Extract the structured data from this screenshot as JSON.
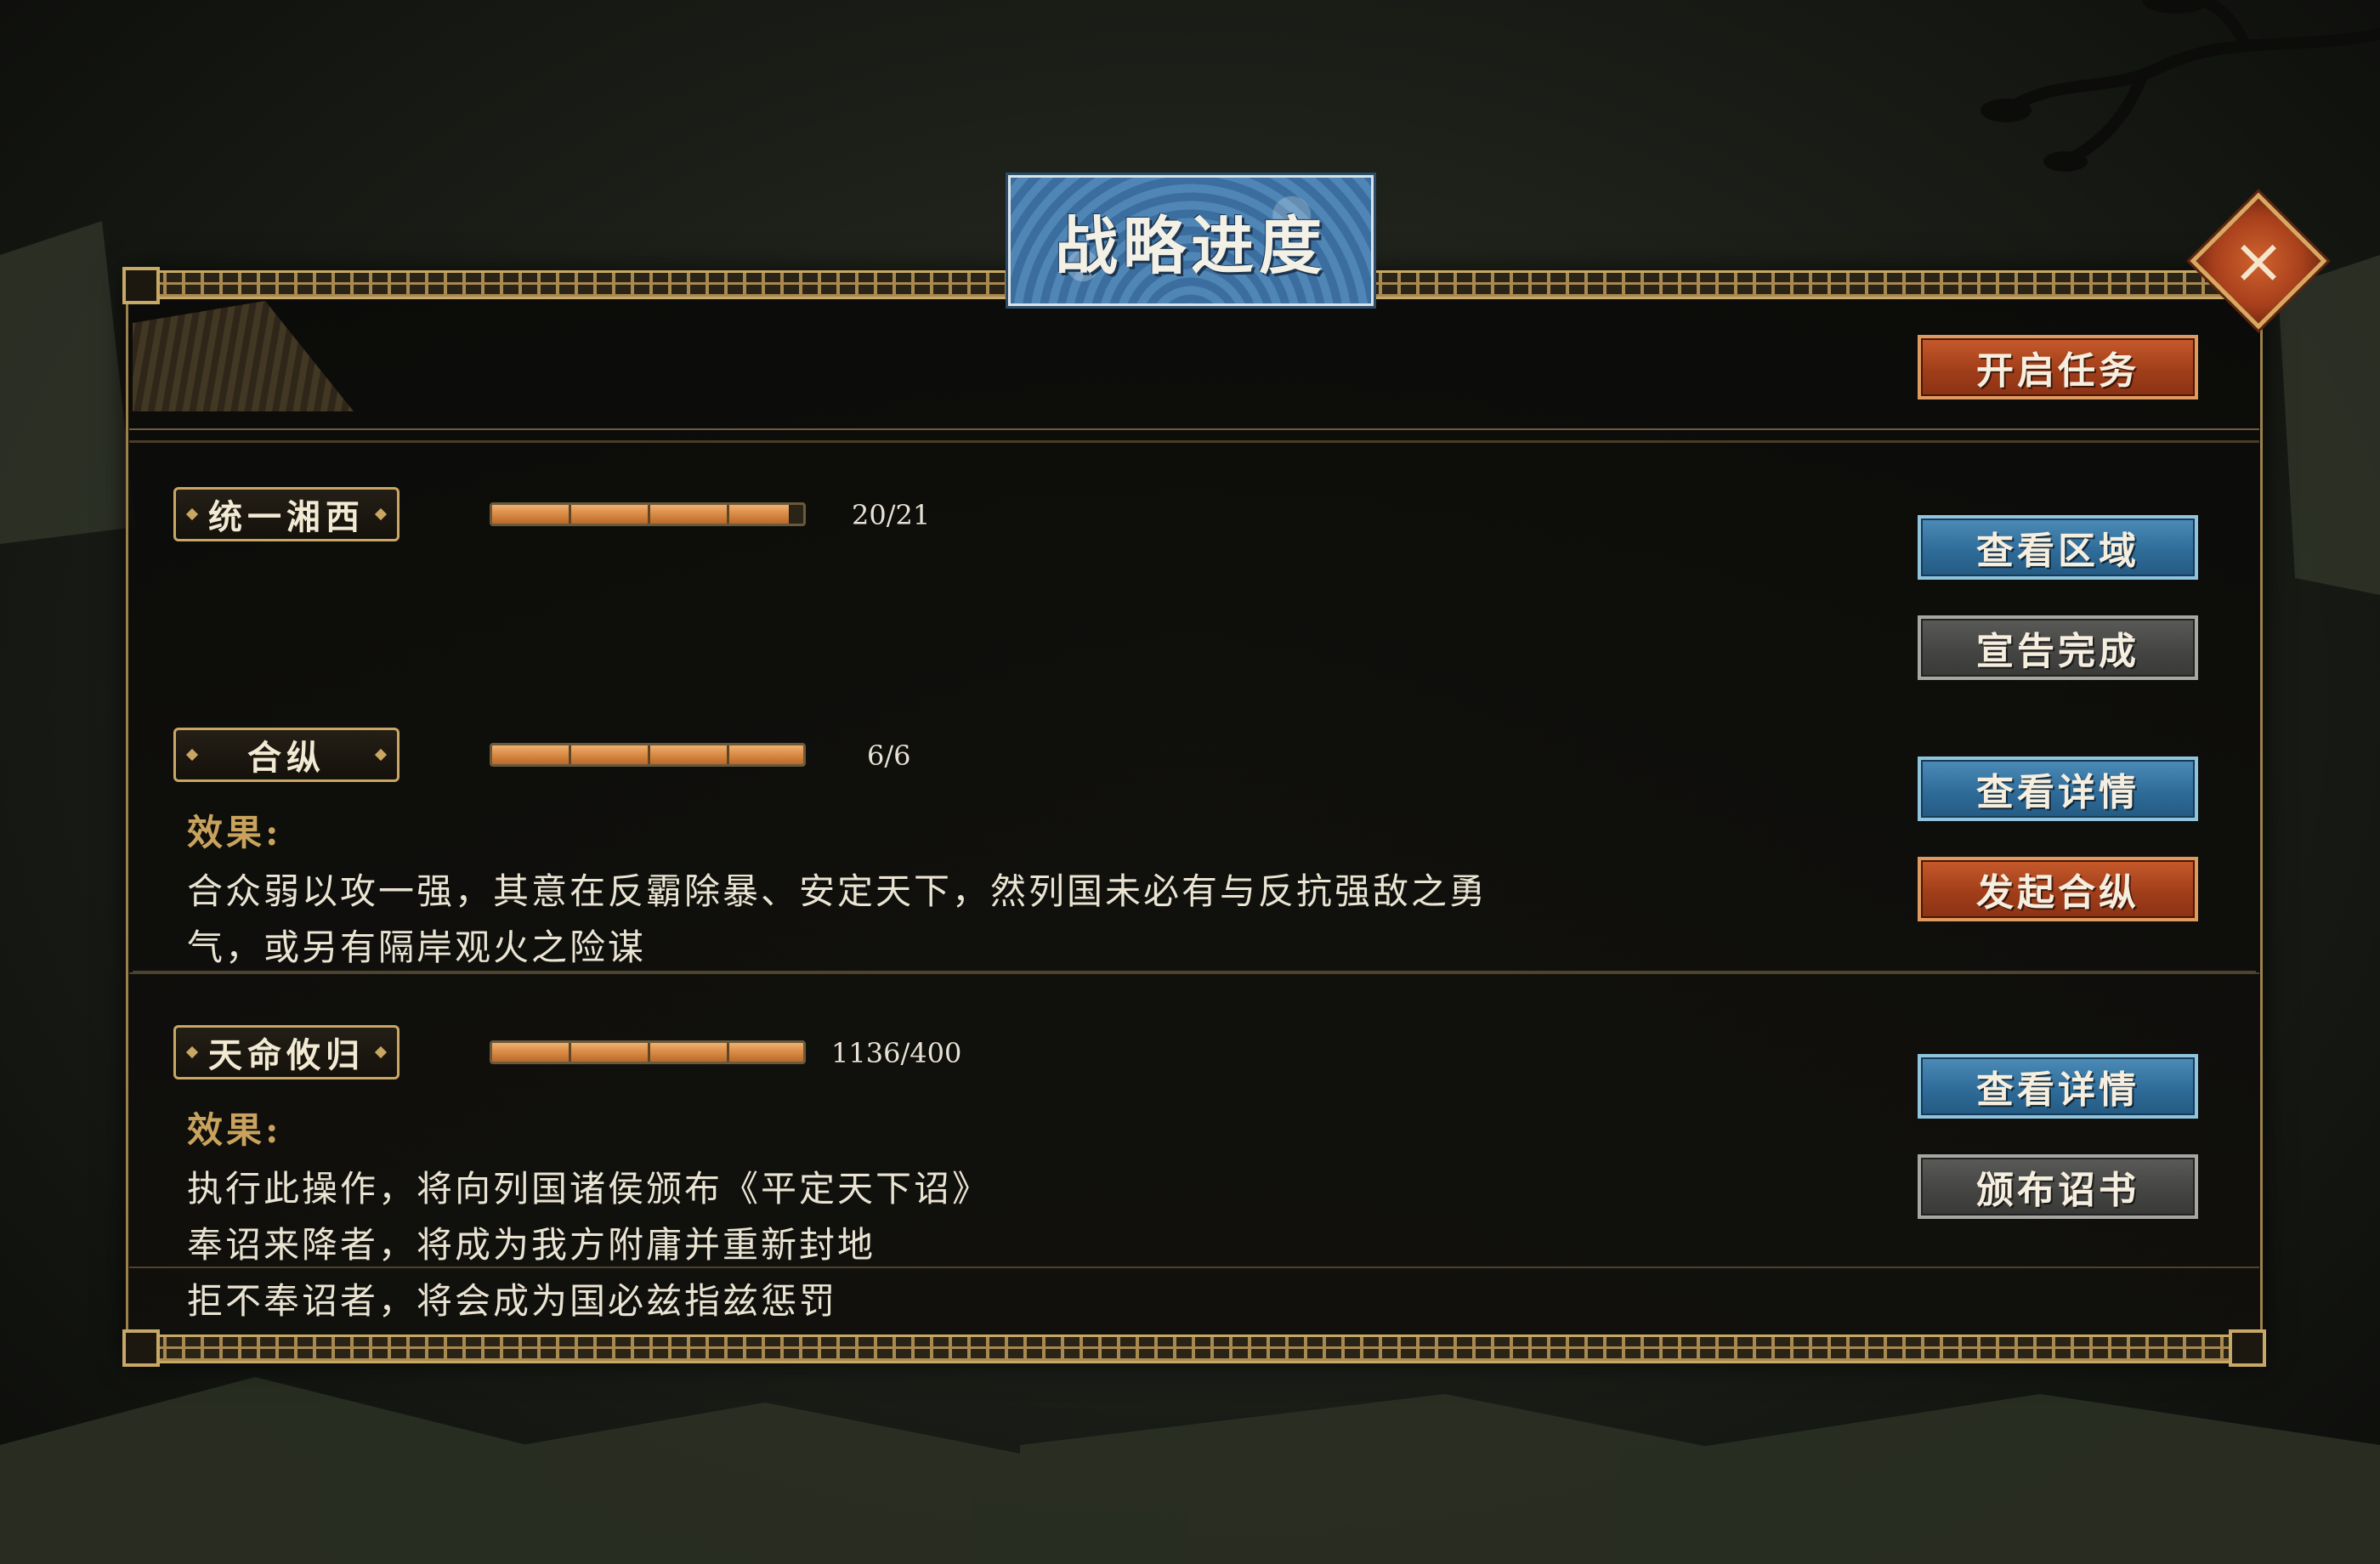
{
  "title": "战略进度",
  "close_icon": "close-x-icon",
  "header": {
    "start_task_label": "开启任务"
  },
  "tasks": [
    {
      "name": "统一湘西",
      "progress": 20,
      "target": 21,
      "progress_text": "20/21",
      "buttons": [
        "查看区域",
        "宣告完成"
      ]
    },
    {
      "name": "合纵",
      "progress": 6,
      "target": 6,
      "progress_text": "6/6",
      "effect_label": "效果:",
      "desc_lines": [
        "合众弱以攻一强，其意在反霸除暴、安定天下，然列国未必有与反抗强敌之勇",
        "气，或另有隔岸观火之险谋"
      ],
      "buttons": [
        "查看详情",
        "发起合纵"
      ]
    },
    {
      "name": "天命攸归",
      "progress": 1136,
      "target": 400,
      "progress_text": "1136/400",
      "effect_label": "效果:",
      "desc_lines": [
        "执行此操作，将向列国诸侯颁布《平定天下诏》",
        "奉诏来降者，将成为我方附庸并重新封地",
        "拒不奉诏者，将会成为国必兹指兹惩罚"
      ],
      "buttons": [
        "查看详情",
        "颁布诏书"
      ]
    }
  ],
  "colors": {
    "accent_gold": "#c9a663",
    "button_red": "#a13e1a",
    "button_blue": "#2f6c99",
    "button_gray": "#454543",
    "bar_orange": "#d98a44"
  }
}
